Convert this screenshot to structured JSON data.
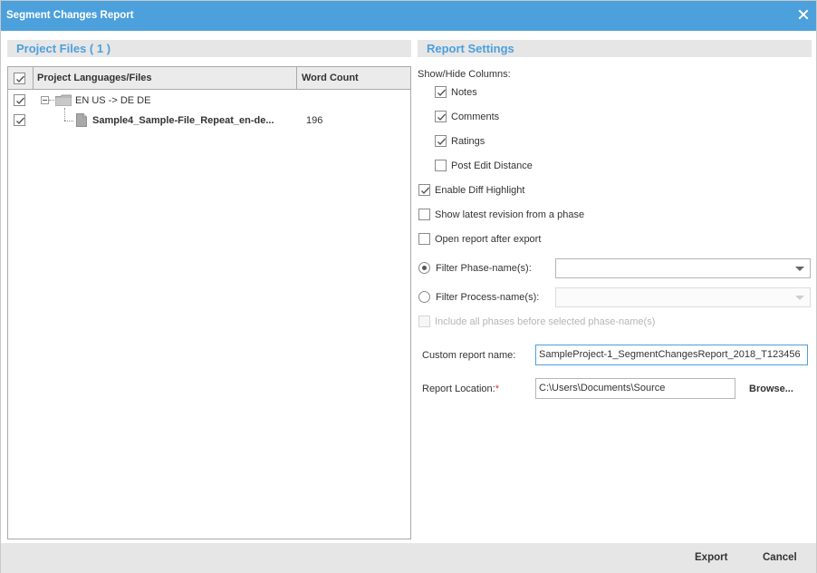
{
  "dialog": {
    "title": "Segment Changes Report"
  },
  "project_files": {
    "header": "Project Files ( 1 )",
    "columns": {
      "languages_files": "Project Languages/Files",
      "word_count": "Word Count"
    },
    "language_pair": {
      "label": "EN US -> DE DE",
      "checked": true
    },
    "file": {
      "name": "Sample4_Sample-File_Repeat_en-de...",
      "word_count": "196",
      "checked": true
    }
  },
  "report_settings": {
    "header": "Report Settings",
    "show_hide_label": "Show/Hide Columns:",
    "columns": {
      "notes": {
        "label": "Notes",
        "checked": true
      },
      "comments": {
        "label": "Comments",
        "checked": true
      },
      "ratings": {
        "label": "Ratings",
        "checked": true
      },
      "post_edit_distance": {
        "label": "Post Edit Distance",
        "checked": false
      }
    },
    "enable_diff_highlight": {
      "label": "Enable Diff Highlight",
      "checked": true
    },
    "show_latest_revision": {
      "label": "Show latest revision from a phase",
      "checked": false
    },
    "open_report_after_export": {
      "label": "Open report after export",
      "checked": false
    },
    "filter_phase": {
      "label": "Filter Phase-name(s):",
      "selected": true,
      "value": ""
    },
    "filter_process": {
      "label": "Filter Process-name(s):",
      "selected": false,
      "value": ""
    },
    "include_all_phases": {
      "label": "Include all phases before selected phase-name(s)",
      "checked": false,
      "disabled": true
    },
    "custom_report_name": {
      "label": "Custom report name:",
      "value": "SampleProject-1_SegmentChangesReport_2018_T123456"
    },
    "report_location": {
      "label": "Report Location:",
      "required_mark": "*",
      "value": "C:\\Users\\Documents\\Source",
      "browse_label": "Browse..."
    }
  },
  "footer": {
    "export_label": "Export",
    "cancel_label": "Cancel"
  },
  "colors": {
    "accent": "#4ca0dc",
    "header_bg": "#e6e6e6",
    "required": "#d9342b"
  }
}
